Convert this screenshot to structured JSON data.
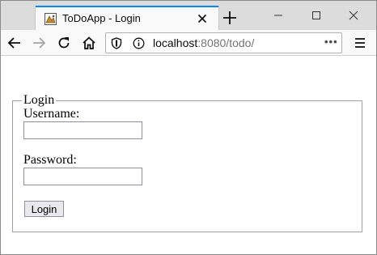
{
  "browser": {
    "tab": {
      "title": "ToDoApp - Login",
      "favicon": "app-favicon-icon"
    },
    "url": {
      "host": "localhost",
      "rest": ":8080/todo/"
    },
    "icons": {
      "close_tab": "close-icon",
      "new_tab": "plus-icon",
      "minimize": "minimize-icon",
      "maximize": "maximize-icon",
      "close_window": "close-icon",
      "back": "arrow-left-icon",
      "forward": "arrow-right-icon",
      "reload": "reload-icon",
      "home": "home-icon",
      "shield": "shield-icon",
      "info": "info-icon",
      "more": "more-icon",
      "menu": "hamburger-menu-icon"
    },
    "more_label": "•••",
    "colors": {
      "tab_accent": "#0a84ff",
      "titlebar": "#dcdcdc",
      "toolbar": "#f9f9fa"
    }
  },
  "page": {
    "fieldset_legend": "Login",
    "username_label": "Username:",
    "username_value": "",
    "password_label": "Password:",
    "password_value": "",
    "login_button": "Login"
  }
}
